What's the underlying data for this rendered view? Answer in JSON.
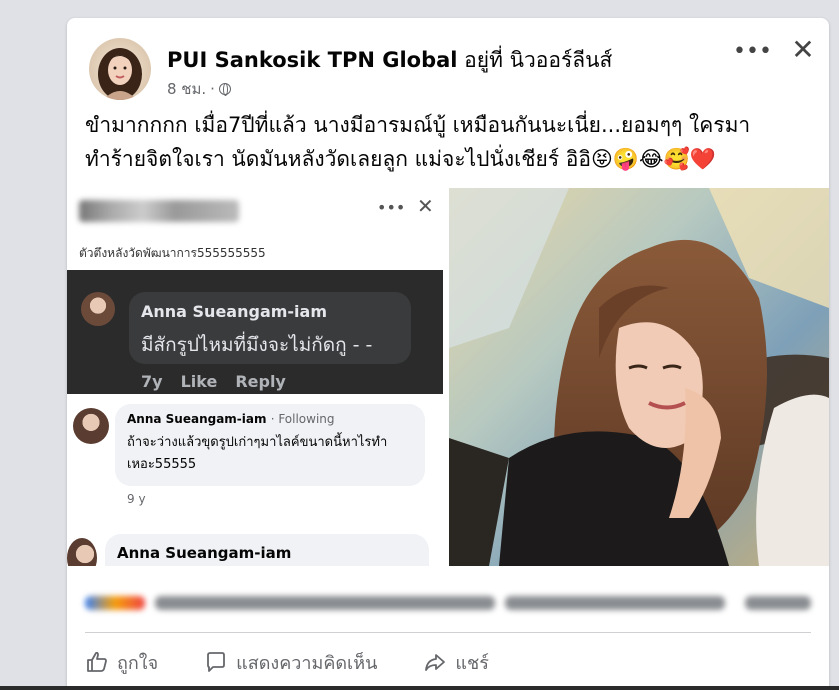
{
  "post": {
    "author_name": "PUI Sankosik TPN Global",
    "location_text": "อยู่ที่ นิวออร์ลีนส์",
    "time": "8 ชม.",
    "separator": "·",
    "text": "ขำมากกกก เมื่อ7ปีที่แล้ว นางมีอารมณ์บู้ เหมือนกันนะเนี่ย...ยอมๆๆ ใครมาทำร้ายจิตใจเรา นัดมันหลังวัดเลยลูก แม่จะไปนั่งเชียร์ อิอิ😝🤪😂🥰❤️",
    "more_label": "•••",
    "close_label": "✕"
  },
  "screenshot": {
    "caption": "ตัวตึงหลังวัดพัฒนาการ555555555",
    "more_label": "•••",
    "close_label": "✕",
    "dark_comment": {
      "name": "Anna Sueangam-iam",
      "text": "มีสักรูปไหมที่มึงจะไม่กัดกู - -",
      "time": "7y",
      "like": "Like",
      "reply": "Reply"
    },
    "light_comment": {
      "name": "Anna Sueangam-iam",
      "follow": "· Following",
      "text": "ถ้าจะว่างแล้วขุดรูปเก่าๆมาไลค์ขนาดนี้หาไรทำเหอะ55555",
      "time": "9 y"
    },
    "third_comment": {
      "name": "Anna Sueangam-iam"
    }
  },
  "actions": {
    "like": "ถูกใจ",
    "comment": "แสดงความคิดเห็น",
    "share": "แชร์"
  },
  "colors": {
    "card": "#ffffff",
    "background": "#dfe1e6",
    "text": "#050505",
    "muted": "#65676b",
    "dark_comment_bg": "#2b2b2b"
  },
  "icons": [
    "more-icon",
    "close-icon",
    "globe-icon",
    "like-icon",
    "comment-icon",
    "share-icon"
  ]
}
